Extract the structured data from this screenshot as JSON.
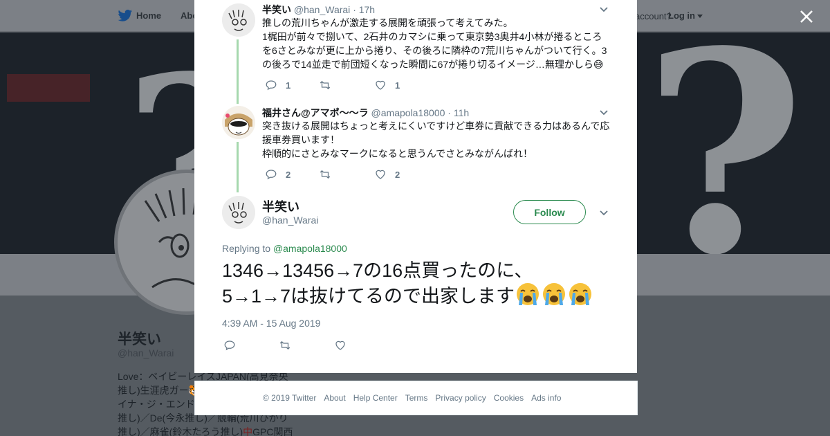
{
  "nav": {
    "home_label": "Home",
    "about_label": "Abo",
    "have_account": "account?",
    "login_label": "Log in"
  },
  "profile": {
    "name": "半笑い",
    "handle": "@han_Warai",
    "bio_lines": [
      "Love：ベイビーレイズJAPAN(高見奈央",
      "推し)生涯虎ガー🐯",
      "イナ・ジ・エンド",
      "推し)／De(今永推し)／競輪(荒川ひかり",
      "推し)／麻雀(鈴木たろう推し)",
      "GPC関西"
    ],
    "bio_red_char": "中"
  },
  "thread": [
    {
      "name": "半笑い",
      "handle": "@han_Warai",
      "time": "· 17h",
      "text": "推しの荒川ちゃんが激走する展開を頑張って考えてみた。\n1梶田が前々で捌いて、2石井のカマシに乗って東京勢3奥井4小林が捲るところを6さとみなが更に上から捲り、その後ろに隣枠の7荒川ちゃんがついて行く。3の後ろで14並走で前団短くなった瞬間に67が捲り切るイメージ…無理かしら😅",
      "reply_count": "1",
      "retweet_count": "",
      "like_count": "1"
    },
    {
      "name": "福井さん@アマポ〜〜ラ",
      "handle": "@amapola18000",
      "time": "· 11h",
      "text": "突き抜ける展開はちょっと考えにくいですけど車券に貢献できる力はあるんで応援車券買います！\n枠順的にさとみなマークになると思うんでさとみながんばれ！",
      "reply_count": "2",
      "retweet_count": "",
      "like_count": "2"
    }
  ],
  "main_tweet": {
    "name": "半笑い",
    "handle": "@han_Warai",
    "follow_label": "Follow",
    "replying_prefix": "Replying to",
    "replying_handle": "@amapola18000",
    "text_line1": "1346→13456→7の16点買ったのに、",
    "text_line2": "5→1→7は抜けてるので出家します",
    "emoji_name": "loudly-crying-face",
    "timestamp": "4:39 AM - 15 Aug 2019"
  },
  "footer": {
    "links": [
      "© 2019 Twitter",
      "About",
      "Help Center",
      "Terms",
      "Privacy policy",
      "Cookies",
      "Ads info"
    ]
  },
  "colors": {
    "accent_green": "#2a8a4e",
    "thread_line": "#a6d8ae",
    "text_primary": "#14171a",
    "text_secondary": "#657786"
  }
}
